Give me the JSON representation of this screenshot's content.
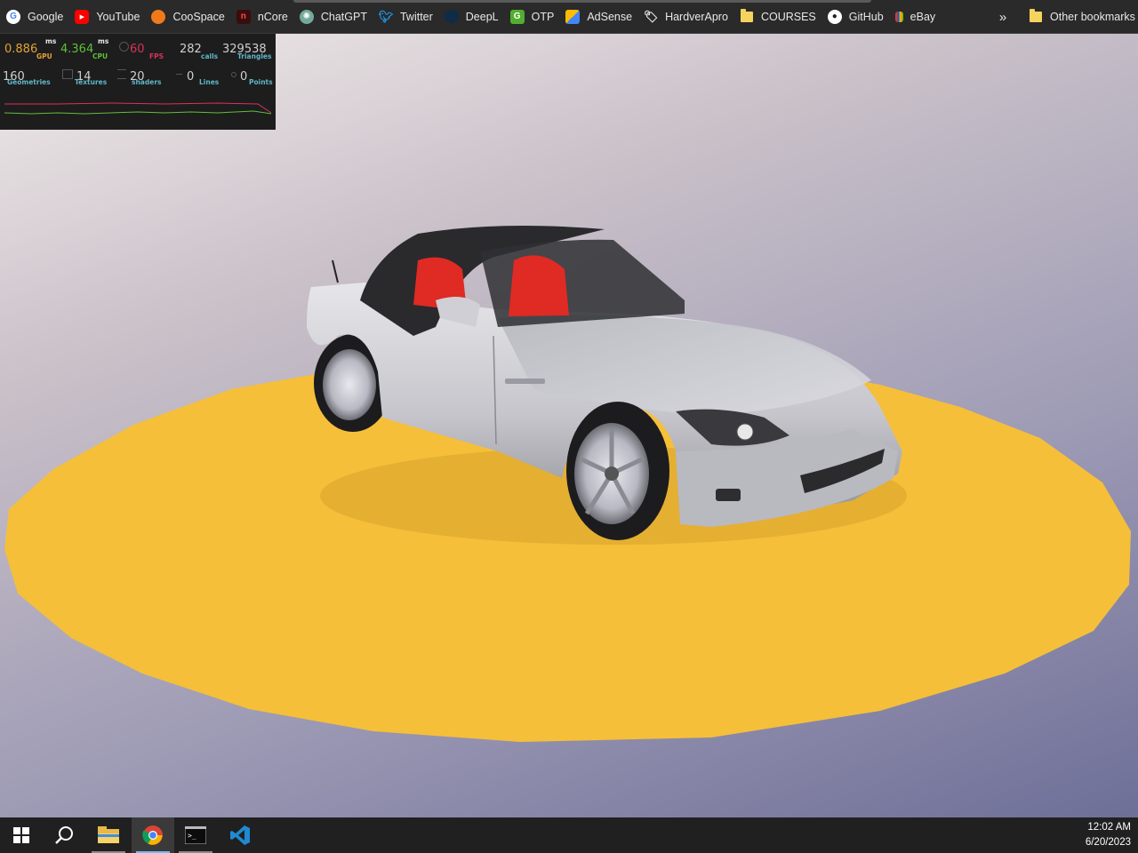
{
  "bookmarks": [
    {
      "label": "Google",
      "icon": "google-icon",
      "color": "#ffffff"
    },
    {
      "label": "YouTube",
      "icon": "youtube-icon",
      "color": "#ff0000"
    },
    {
      "label": "CooSpace",
      "icon": "coospace-icon",
      "color": "#f07a1a"
    },
    {
      "label": "nCore",
      "icon": "ncore-icon",
      "color": "#8b1a1a"
    },
    {
      "label": "ChatGPT",
      "icon": "chatgpt-icon",
      "color": "#74aa9c"
    },
    {
      "label": "Twitter",
      "icon": "twitter-icon",
      "color": "#1d9bf0"
    },
    {
      "label": "DeepL",
      "icon": "deepl-icon",
      "color": "#0f2b46"
    },
    {
      "label": "OTP",
      "icon": "otp-icon",
      "color": "#52ae30"
    },
    {
      "label": "AdSense",
      "icon": "adsense-icon",
      "color": "#fbbc04"
    },
    {
      "label": "HardverApro",
      "icon": "hardverapro-icon",
      "color": "#e8e8e8"
    },
    {
      "label": "COURSES",
      "icon": "folder-icon",
      "color": "#f4d35e"
    },
    {
      "label": "GitHub",
      "icon": "github-icon",
      "color": "#ffffff"
    },
    {
      "label": "eBay",
      "icon": "ebay-icon",
      "color": "#e53238"
    }
  ],
  "overflow_label": "»",
  "other_bookmarks": "Other bookmarks",
  "stats": {
    "gpu": {
      "value": "0.886",
      "unit": "ms",
      "label": "GPU",
      "color": "#e2a238"
    },
    "cpu": {
      "value": "4.364",
      "unit": "ms",
      "label": "CPU",
      "color": "#5fbf3a"
    },
    "fps": {
      "value": "60",
      "label": "FPS",
      "color": "#d9325a"
    },
    "calls": {
      "value": "282",
      "label": "calls"
    },
    "triangles": {
      "value": "329538",
      "label": "Triangles"
    },
    "geometries": {
      "value": "160",
      "label": "Geometries"
    },
    "textures": {
      "value": "14",
      "label": "Textures"
    },
    "shaders": {
      "value": "20",
      "label": "shaders"
    },
    "lines": {
      "value": "0",
      "label": "Lines"
    },
    "points": {
      "value": "0",
      "label": "Points"
    }
  },
  "scene": {
    "platform_color": "#f5bf3a",
    "car_body_color": "#c8c8cc",
    "seat_color": "#e02a24",
    "roof_color": "#2a2a2c"
  },
  "taskbar": {
    "apps": [
      {
        "name": "start-button",
        "icon": "windows-icon"
      },
      {
        "name": "search-button",
        "icon": "search-icon"
      },
      {
        "name": "file-explorer",
        "icon": "folder-icon"
      },
      {
        "name": "chrome",
        "icon": "chrome-icon"
      },
      {
        "name": "terminal",
        "icon": "terminal-icon"
      },
      {
        "name": "vscode",
        "icon": "vscode-icon"
      }
    ],
    "time": "12:02 AM",
    "date": "6/20/2023"
  }
}
